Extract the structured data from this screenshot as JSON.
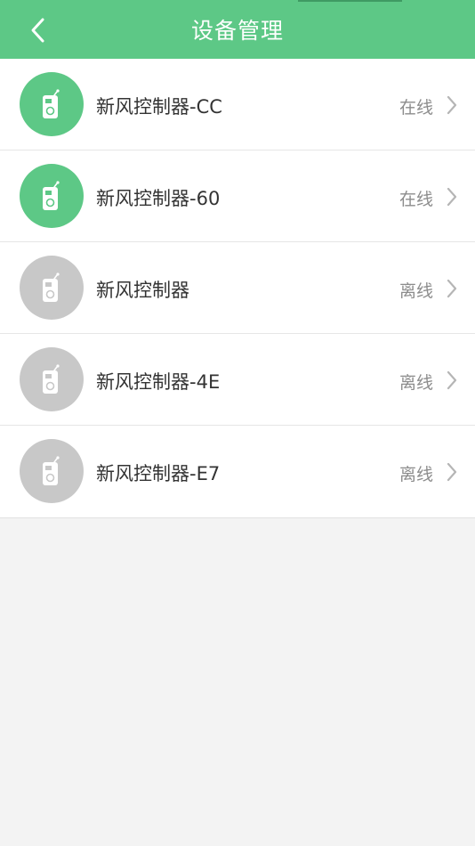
{
  "header": {
    "title": "设备管理",
    "back_icon": "chevron-left-icon",
    "color": "#5dc886"
  },
  "colors": {
    "online": "#5dc886",
    "offline": "#c8c8c8"
  },
  "devices": [
    {
      "name": "新风控制器-CC",
      "status": "在线",
      "online": true,
      "icon": "air-controller-icon"
    },
    {
      "name": "新风控制器-60",
      "status": "在线",
      "online": true,
      "icon": "air-controller-icon"
    },
    {
      "name": "新风控制器",
      "status": "离线",
      "online": false,
      "icon": "air-controller-icon"
    },
    {
      "name": "新风控制器-4E",
      "status": "离线",
      "online": false,
      "icon": "air-controller-icon"
    },
    {
      "name": "新风控制器-E7",
      "status": "离线",
      "online": false,
      "icon": "air-controller-icon"
    }
  ]
}
